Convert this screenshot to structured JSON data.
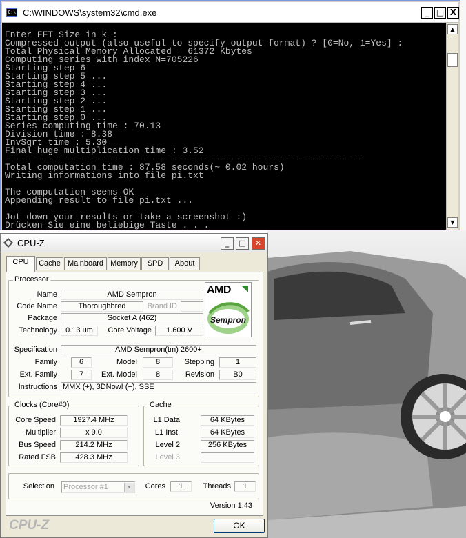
{
  "cmd": {
    "title": "C:\\WINDOWS\\system32\\cmd.exe",
    "icon": "C:\\",
    "buttons": {
      "minimize": "_",
      "maximize": "□",
      "close": "X"
    },
    "output": [
      "Enter FFT Size in k :",
      "Compressed output (also useful to specify output format) ? [0=No, 1=Yes] :",
      "Total Physical Memory Allocated = 61372 Kbytes",
      "Computing series with index N=705226",
      "Starting step 6",
      "Starting step 5 ...",
      "Starting step 4 ...",
      "Starting step 3 ...",
      "Starting step 2 ...",
      "Starting step 1 ...",
      "Starting step 0 ...",
      "Series computing time : 70.13",
      "Division time : 8.38",
      "InvSqrt time : 5.30",
      "Final huge multiplication time : 3.52",
      "-------------------------------------------------------------------",
      "Total computation time : 87.58 seconds(~ 0.02 hours)",
      "Writing informations into file pi.txt",
      "",
      "The computation seems OK",
      "Appending result to file pi.txt ...",
      "",
      "Jot down your results or take a screenshot :)",
      "Drücken Sie eine beliebige Taste . . ."
    ]
  },
  "cpuz": {
    "title": "CPU-Z",
    "tabs": [
      "CPU",
      "Cache",
      "Mainboard",
      "Memory",
      "SPD",
      "About"
    ],
    "processor": {
      "title": "Processor",
      "name_label": "Name",
      "name": "AMD Sempron",
      "code_name_label": "Code Name",
      "code_name": "Thoroughbred",
      "brand_id_label": "Brand ID",
      "brand_id": "",
      "package_label": "Package",
      "package": "Socket A (462)",
      "technology_label": "Technology",
      "technology": "0.13 um",
      "core_voltage_label": "Core Voltage",
      "core_voltage": "1.600 V",
      "specification_label": "Specification",
      "specification": "AMD Sempron(tm) 2600+",
      "family_label": "Family",
      "family": "6",
      "model_label": "Model",
      "model": "8",
      "stepping_label": "Stepping",
      "stepping": "1",
      "ext_family_label": "Ext. Family",
      "ext_family": "7",
      "ext_model_label": "Ext. Model",
      "ext_model": "8",
      "revision_label": "Revision",
      "revision": "B0",
      "instructions_label": "Instructions",
      "instructions": "MMX (+), 3DNow! (+), SSE",
      "logo_brand": "AMD",
      "logo_product": "Sempron"
    },
    "clocks": {
      "title": "Clocks (Core#0)",
      "core_speed_label": "Core Speed",
      "core_speed": "1927.4 MHz",
      "multiplier_label": "Multiplier",
      "multiplier": "x 9.0",
      "bus_speed_label": "Bus Speed",
      "bus_speed": "214.2 MHz",
      "rated_fsb_label": "Rated FSB",
      "rated_fsb": "428.3 MHz"
    },
    "cache": {
      "title": "Cache",
      "l1_data_label": "L1 Data",
      "l1_data": "64 KBytes",
      "l1_inst_label": "L1 Inst.",
      "l1_inst": "64 KBytes",
      "level2_label": "Level 2",
      "level2": "256 KBytes",
      "level3_label": "Level 3",
      "level3": ""
    },
    "selection": {
      "label": "Selection",
      "value": "Processor #1",
      "cores_label": "Cores",
      "cores": "1",
      "threads_label": "Threads",
      "threads": "1"
    },
    "version": "Version 1.43",
    "footer_logo": "CPU-Z",
    "ok_label": "OK"
  }
}
